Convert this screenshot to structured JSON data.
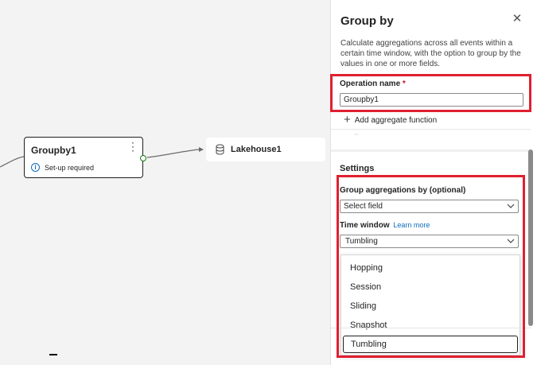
{
  "canvas": {
    "nodes": [
      {
        "title": "Groupby1",
        "status": "Set-up required"
      },
      {
        "title": "Lakehouse1"
      }
    ]
  },
  "panel": {
    "title": "Group by",
    "description": "Calculate aggregations across all events within a certain time window, with the option to group by the values in one or more fields.",
    "operation_name_label": "Operation name",
    "required_marker": "*",
    "operation_name_value": "Groupby1",
    "add_function_label": "Add aggregate function",
    "settings_label": "Settings",
    "group_by_label": "Group aggregations by (optional)",
    "group_by_value": "Select field",
    "time_window_label": "Time window",
    "learn_more": "Learn more",
    "time_window_value": "Tumbling",
    "time_window_options": [
      "Hopping",
      "Session",
      "Sliding",
      "Snapshot",
      "Tumbling"
    ]
  },
  "colors": {
    "highlight": "#e02030",
    "link": "#0f6cbd",
    "port": "#107c10"
  }
}
